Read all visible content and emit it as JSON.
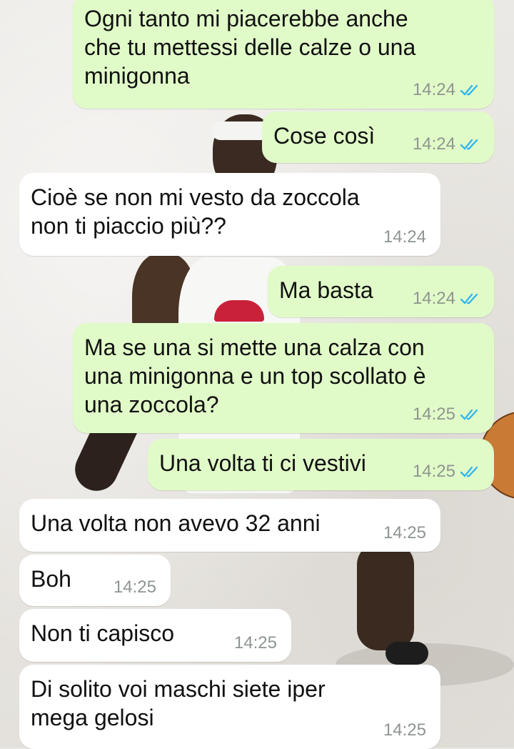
{
  "conversation": {
    "messages": [
      {
        "direction": "out",
        "text": "Ogni tanto mi piacerebbe anche\nche tu mettessi delle calze o una\nminigonna",
        "time": "14:24",
        "status": "read"
      },
      {
        "direction": "out",
        "text": "Cose così",
        "time": "14:24",
        "status": "read"
      },
      {
        "direction": "in",
        "text": "Cioè se non mi vesto da zoccola\nnon ti piaccio più??",
        "time": "14:24"
      },
      {
        "direction": "out",
        "text": "Ma basta",
        "time": "14:24",
        "status": "read"
      },
      {
        "direction": "out",
        "text": "Ma se una si mette una calza con\nuna minigonna e un top scollato è\nuna zoccola?",
        "time": "14:25",
        "status": "read"
      },
      {
        "direction": "out",
        "text": "Una volta ti ci vestivi",
        "time": "14:25",
        "status": "read"
      },
      {
        "direction": "in",
        "text": "Una volta non avevo 32 anni",
        "time": "14:25"
      },
      {
        "direction": "in",
        "text": "Boh",
        "time": "14:25"
      },
      {
        "direction": "in",
        "text": "Non ti capisco",
        "time": "14:25"
      },
      {
        "direction": "in",
        "text": "Di solito voi maschi siete iper\nmega gelosi",
        "time": "14:25"
      }
    ]
  },
  "colors": {
    "outgoing_bubble": "#e1fbc8",
    "incoming_bubble": "#ffffff",
    "read_tick": "#34b7f1",
    "timestamp": "#8e9590"
  },
  "icons": {
    "read_receipt": "double-check-icon"
  }
}
